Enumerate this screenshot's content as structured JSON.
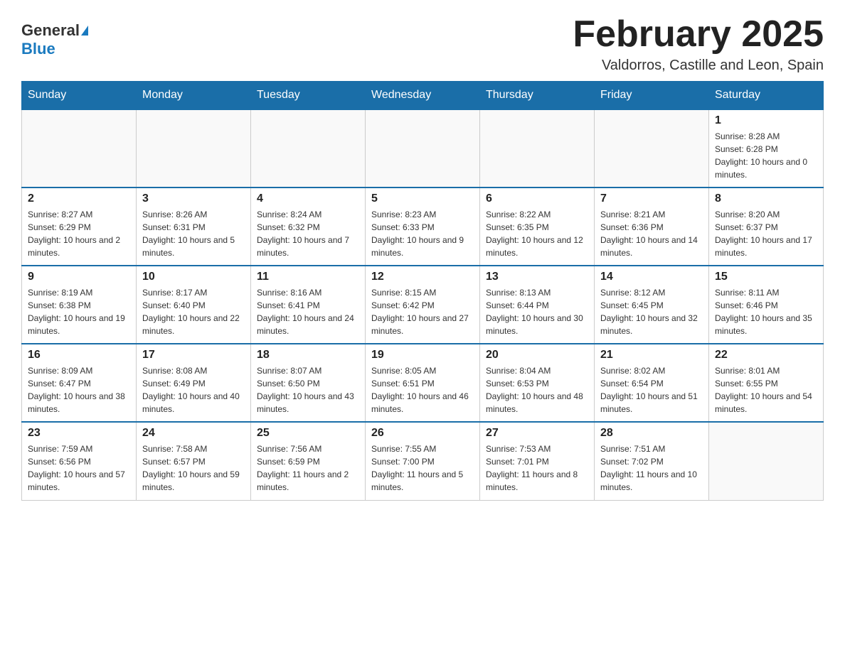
{
  "logo": {
    "general": "General",
    "blue": "Blue"
  },
  "header": {
    "month_year": "February 2025",
    "location": "Valdorros, Castille and Leon, Spain"
  },
  "days_of_week": [
    "Sunday",
    "Monday",
    "Tuesday",
    "Wednesday",
    "Thursday",
    "Friday",
    "Saturday"
  ],
  "weeks": [
    [
      {
        "day": "",
        "info": ""
      },
      {
        "day": "",
        "info": ""
      },
      {
        "day": "",
        "info": ""
      },
      {
        "day": "",
        "info": ""
      },
      {
        "day": "",
        "info": ""
      },
      {
        "day": "",
        "info": ""
      },
      {
        "day": "1",
        "info": "Sunrise: 8:28 AM\nSunset: 6:28 PM\nDaylight: 10 hours and 0 minutes."
      }
    ],
    [
      {
        "day": "2",
        "info": "Sunrise: 8:27 AM\nSunset: 6:29 PM\nDaylight: 10 hours and 2 minutes."
      },
      {
        "day": "3",
        "info": "Sunrise: 8:26 AM\nSunset: 6:31 PM\nDaylight: 10 hours and 5 minutes."
      },
      {
        "day": "4",
        "info": "Sunrise: 8:24 AM\nSunset: 6:32 PM\nDaylight: 10 hours and 7 minutes."
      },
      {
        "day": "5",
        "info": "Sunrise: 8:23 AM\nSunset: 6:33 PM\nDaylight: 10 hours and 9 minutes."
      },
      {
        "day": "6",
        "info": "Sunrise: 8:22 AM\nSunset: 6:35 PM\nDaylight: 10 hours and 12 minutes."
      },
      {
        "day": "7",
        "info": "Sunrise: 8:21 AM\nSunset: 6:36 PM\nDaylight: 10 hours and 14 minutes."
      },
      {
        "day": "8",
        "info": "Sunrise: 8:20 AM\nSunset: 6:37 PM\nDaylight: 10 hours and 17 minutes."
      }
    ],
    [
      {
        "day": "9",
        "info": "Sunrise: 8:19 AM\nSunset: 6:38 PM\nDaylight: 10 hours and 19 minutes."
      },
      {
        "day": "10",
        "info": "Sunrise: 8:17 AM\nSunset: 6:40 PM\nDaylight: 10 hours and 22 minutes."
      },
      {
        "day": "11",
        "info": "Sunrise: 8:16 AM\nSunset: 6:41 PM\nDaylight: 10 hours and 24 minutes."
      },
      {
        "day": "12",
        "info": "Sunrise: 8:15 AM\nSunset: 6:42 PM\nDaylight: 10 hours and 27 minutes."
      },
      {
        "day": "13",
        "info": "Sunrise: 8:13 AM\nSunset: 6:44 PM\nDaylight: 10 hours and 30 minutes."
      },
      {
        "day": "14",
        "info": "Sunrise: 8:12 AM\nSunset: 6:45 PM\nDaylight: 10 hours and 32 minutes."
      },
      {
        "day": "15",
        "info": "Sunrise: 8:11 AM\nSunset: 6:46 PM\nDaylight: 10 hours and 35 minutes."
      }
    ],
    [
      {
        "day": "16",
        "info": "Sunrise: 8:09 AM\nSunset: 6:47 PM\nDaylight: 10 hours and 38 minutes."
      },
      {
        "day": "17",
        "info": "Sunrise: 8:08 AM\nSunset: 6:49 PM\nDaylight: 10 hours and 40 minutes."
      },
      {
        "day": "18",
        "info": "Sunrise: 8:07 AM\nSunset: 6:50 PM\nDaylight: 10 hours and 43 minutes."
      },
      {
        "day": "19",
        "info": "Sunrise: 8:05 AM\nSunset: 6:51 PM\nDaylight: 10 hours and 46 minutes."
      },
      {
        "day": "20",
        "info": "Sunrise: 8:04 AM\nSunset: 6:53 PM\nDaylight: 10 hours and 48 minutes."
      },
      {
        "day": "21",
        "info": "Sunrise: 8:02 AM\nSunset: 6:54 PM\nDaylight: 10 hours and 51 minutes."
      },
      {
        "day": "22",
        "info": "Sunrise: 8:01 AM\nSunset: 6:55 PM\nDaylight: 10 hours and 54 minutes."
      }
    ],
    [
      {
        "day": "23",
        "info": "Sunrise: 7:59 AM\nSunset: 6:56 PM\nDaylight: 10 hours and 57 minutes."
      },
      {
        "day": "24",
        "info": "Sunrise: 7:58 AM\nSunset: 6:57 PM\nDaylight: 10 hours and 59 minutes."
      },
      {
        "day": "25",
        "info": "Sunrise: 7:56 AM\nSunset: 6:59 PM\nDaylight: 11 hours and 2 minutes."
      },
      {
        "day": "26",
        "info": "Sunrise: 7:55 AM\nSunset: 7:00 PM\nDaylight: 11 hours and 5 minutes."
      },
      {
        "day": "27",
        "info": "Sunrise: 7:53 AM\nSunset: 7:01 PM\nDaylight: 11 hours and 8 minutes."
      },
      {
        "day": "28",
        "info": "Sunrise: 7:51 AM\nSunset: 7:02 PM\nDaylight: 11 hours and 10 minutes."
      },
      {
        "day": "",
        "info": ""
      }
    ]
  ]
}
